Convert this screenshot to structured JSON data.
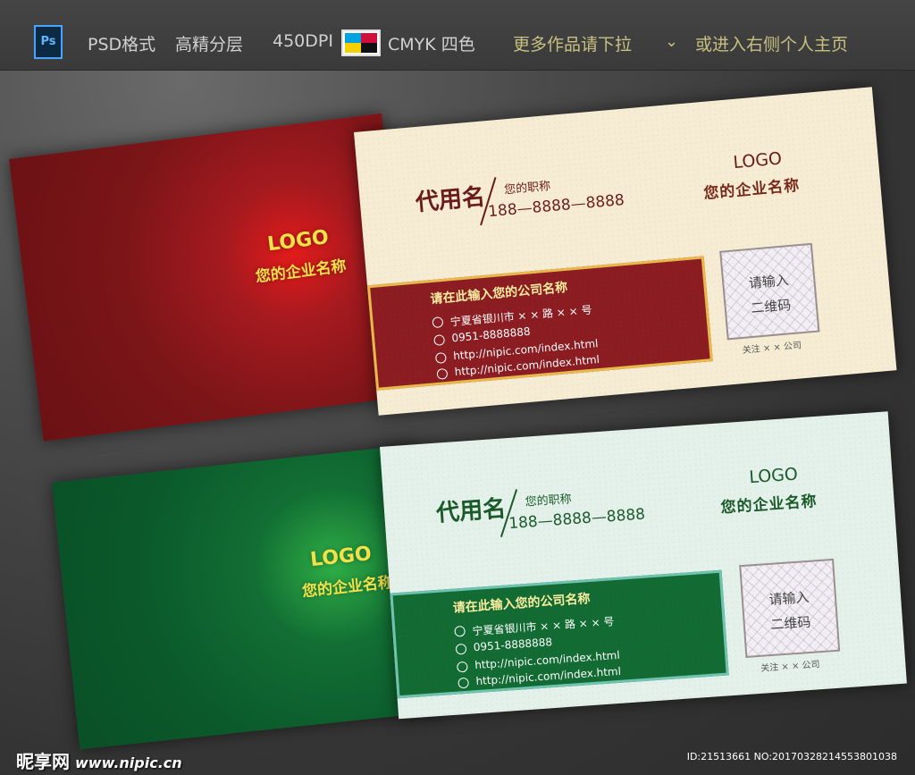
{
  "banner": {
    "ps_icon": "Ps",
    "format": "PSD格式",
    "layers": "高精分层",
    "dpi": "450DPI",
    "color_mode": "CMYK 四色",
    "more_works": "更多作品请下拉",
    "enter_home": "或进入右侧个人主页",
    "colors": {
      "cyan": "#00a3e0",
      "magenta": "#d0103a",
      "yellow": "#f5d000",
      "black": "#111111"
    }
  },
  "red_card": {
    "back": {
      "logo": "LOGO",
      "company": "您的企业名称"
    },
    "front": {
      "name": "代用名",
      "job_title": "您的职称",
      "phone": "188—8888—8888",
      "logo": "LOGO",
      "company": "您的企业名称",
      "band_title": "请在此输入您的公司名称",
      "address": "宁夏省银川市 × × 路 × × 号",
      "tel": "0951-8888888",
      "web1": "http://nipic.com/index.html",
      "web2": "http://nipic.com/index.html",
      "qr_line1": "请输入",
      "qr_line2": "二维码",
      "follow": "关注 × × 公司"
    },
    "colors": {
      "back": "#7b1518",
      "front_bg": "#f6ecd3",
      "text": "#6b1a1a",
      "band": "#8b1c22",
      "band_border": "#e8b84a"
    }
  },
  "green_card": {
    "back": {
      "logo": "LOGO",
      "company": "您的企业名称"
    },
    "front": {
      "name": "代用名",
      "job_title": "您的职称",
      "phone": "188—8888—8888",
      "logo": "LOGO",
      "company": "您的企业名称",
      "band_title": "请在此输入您的公司名称",
      "address": "宁夏省银川市 × × 路 × × 号",
      "tel": "0951-8888888",
      "web1": "http://nipic.com/index.html",
      "web2": "http://nipic.com/index.html",
      "qr_line1": "请输入",
      "qr_line2": "二维码",
      "follow": "关注 × × 公司"
    },
    "colors": {
      "back": "#0b5a2b",
      "front_bg": "#e3f1ea",
      "text": "#1a5a2a",
      "band": "#116b32",
      "band_border": "#6fc3b0"
    }
  },
  "watermark": {
    "brand": "昵享网",
    "site": "www.nipic.cn",
    "id_text": "ID:21513661 NO:20170328214553801038"
  }
}
